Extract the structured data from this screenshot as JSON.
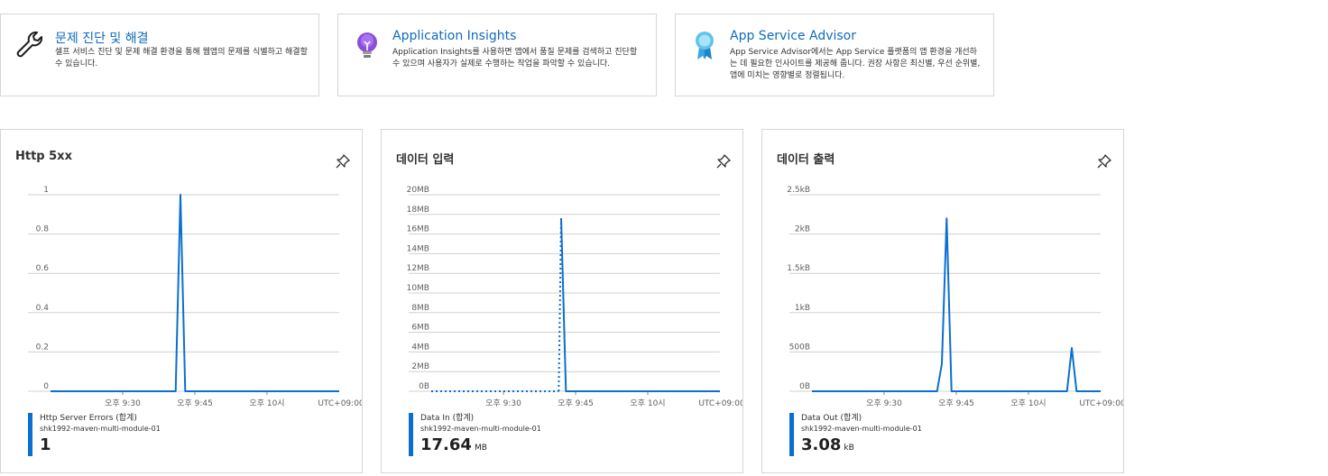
{
  "cards": [
    {
      "title": "문제 진단 및 해결",
      "desc": "셀프 서비스 진단 및 문제 해결 환경을 통해 웹앱의 문제를 식별하고 해결할 수 있습니다.",
      "icon": "wrench-icon"
    },
    {
      "title": "Application Insights",
      "desc": "Application Insights를 사용하면 앱에서 품질 문제를 검색하고 진단할 수 있으며 사용자가 실제로 수행하는 작업을 파악할 수 있습니다.",
      "icon": "lightbulb-icon"
    },
    {
      "title": "App Service Advisor",
      "desc": "App Service Advisor에서는 App Service 플랫폼의 앱 환경을 개선하는 데 필요한 인사이트를 제공해 줍니다. 권장 사항은 최신별, 우선 순위별, 앱에 미치는 영향별로 정렬됩니다.",
      "icon": "ribbon-icon"
    }
  ],
  "colors": {
    "accent": "#0f6cbd",
    "line": "#0b6fcf",
    "grid": "#d0d0d0",
    "border": "#d6d6d6"
  },
  "chart_data": [
    {
      "type": "line",
      "title": "Http 5xx",
      "y_tick_labels": [
        "0",
        "0.2",
        "0.4",
        "0.6",
        "0.8",
        "1"
      ],
      "ylim": [
        0,
        1
      ],
      "x_tick_labels": [
        "오후 9:30",
        "오후 9:45",
        "오후 10시"
      ],
      "timezone": "UTC+09:00",
      "series": [
        {
          "name": "Http Server Errors (합계)",
          "points": [
            [
              0,
              0
            ],
            [
              26,
              0
            ],
            [
              27,
              1
            ],
            [
              28,
              0
            ],
            [
              60,
              0
            ]
          ]
        }
      ],
      "legend": {
        "name": "Http Server Errors (합계)",
        "resource": "shk1992-maven-multi-module-01",
        "value": "1",
        "unit": ""
      }
    },
    {
      "type": "line",
      "title": "데이터 입력",
      "y_tick_labels": [
        "0B",
        "2MB",
        "4MB",
        "6MB",
        "8MB",
        "10MB",
        "12MB",
        "14MB",
        "16MB",
        "18MB",
        "20MB"
      ],
      "ylim": [
        0,
        20
      ],
      "x_tick_labels": [
        "오후 9:30",
        "오후 9:45",
        "오후 10시"
      ],
      "timezone": "UTC+09:00",
      "series": [
        {
          "name": "Data In (합계)",
          "points": [
            [
              0,
              0
            ],
            [
              26,
              0
            ],
            [
              27,
              17.6
            ],
            [
              28,
              0
            ],
            [
              60,
              0
            ]
          ],
          "dashed_ranges": [
            [
              0,
              26.5
            ]
          ]
        }
      ],
      "legend": {
        "name": "Data In (합계)",
        "resource": "shk1992-maven-multi-module-01",
        "value": "17.64",
        "unit": "MB"
      }
    },
    {
      "type": "line",
      "title": "데이터 출력",
      "y_tick_labels": [
        "0B",
        "500B",
        "1kB",
        "1.5kB",
        "2kB",
        "2.5kB"
      ],
      "ylim": [
        0,
        2.5
      ],
      "x_tick_labels": [
        "오후 9:30",
        "오후 9:45",
        "오후 10시"
      ],
      "timezone": "UTC+09:00",
      "series": [
        {
          "name": "Data Out (합계)",
          "points": [
            [
              0,
              0
            ],
            [
              26,
              0
            ],
            [
              27,
              0.35
            ],
            [
              28,
              2.2
            ],
            [
              29,
              0
            ],
            [
              53,
              0
            ],
            [
              54,
              0.55
            ],
            [
              55,
              0
            ],
            [
              60,
              0
            ]
          ]
        }
      ],
      "legend": {
        "name": "Data Out (합계)",
        "resource": "shk1992-maven-multi-module-01",
        "value": "3.08",
        "unit": "kB"
      }
    }
  ]
}
